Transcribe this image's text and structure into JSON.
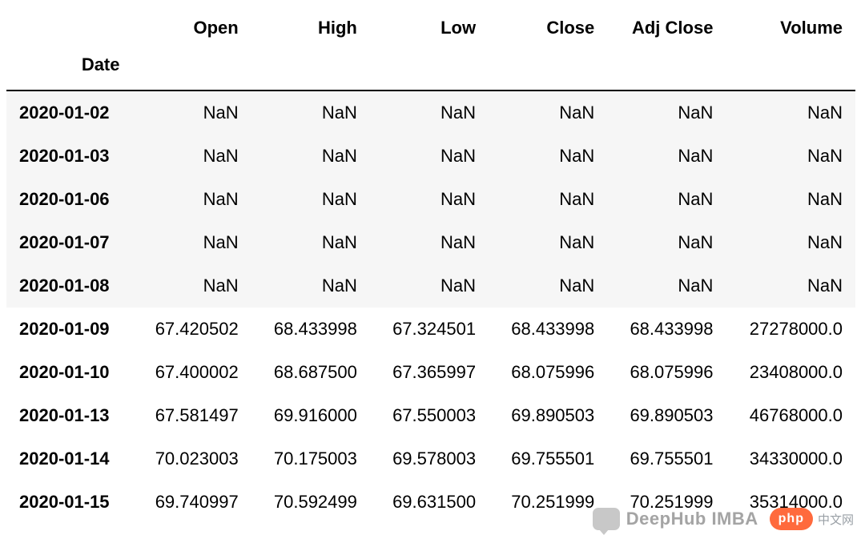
{
  "index_name": "Date",
  "columns": [
    "Open",
    "High",
    "Low",
    "Close",
    "Adj Close",
    "Volume"
  ],
  "rows": [
    {
      "date": "2020-01-02",
      "open": "NaN",
      "high": "NaN",
      "low": "NaN",
      "close": "NaN",
      "adj_close": "NaN",
      "volume": "NaN"
    },
    {
      "date": "2020-01-03",
      "open": "NaN",
      "high": "NaN",
      "low": "NaN",
      "close": "NaN",
      "adj_close": "NaN",
      "volume": "NaN"
    },
    {
      "date": "2020-01-06",
      "open": "NaN",
      "high": "NaN",
      "low": "NaN",
      "close": "NaN",
      "adj_close": "NaN",
      "volume": "NaN"
    },
    {
      "date": "2020-01-07",
      "open": "NaN",
      "high": "NaN",
      "low": "NaN",
      "close": "NaN",
      "adj_close": "NaN",
      "volume": "NaN"
    },
    {
      "date": "2020-01-08",
      "open": "NaN",
      "high": "NaN",
      "low": "NaN",
      "close": "NaN",
      "adj_close": "NaN",
      "volume": "NaN"
    },
    {
      "date": "2020-01-09",
      "open": "67.420502",
      "high": "68.433998",
      "low": "67.324501",
      "close": "68.433998",
      "adj_close": "68.433998",
      "volume": "27278000.0"
    },
    {
      "date": "2020-01-10",
      "open": "67.400002",
      "high": "68.687500",
      "low": "67.365997",
      "close": "68.075996",
      "adj_close": "68.075996",
      "volume": "23408000.0"
    },
    {
      "date": "2020-01-13",
      "open": "67.581497",
      "high": "69.916000",
      "low": "67.550003",
      "close": "69.890503",
      "adj_close": "69.890503",
      "volume": "46768000.0"
    },
    {
      "date": "2020-01-14",
      "open": "70.023003",
      "high": "70.175003",
      "low": "69.578003",
      "close": "69.755501",
      "adj_close": "69.755501",
      "volume": "34330000.0"
    },
    {
      "date": "2020-01-15",
      "open": "69.740997",
      "high": "70.592499",
      "low": "69.631500",
      "close": "70.251999",
      "adj_close": "70.251999",
      "volume": "35314000.0"
    }
  ],
  "zebra_first_n": 5,
  "watermark": {
    "deephub_text": "DeepHub IMBA",
    "php_badge": "php",
    "php_cn": "中文网"
  }
}
